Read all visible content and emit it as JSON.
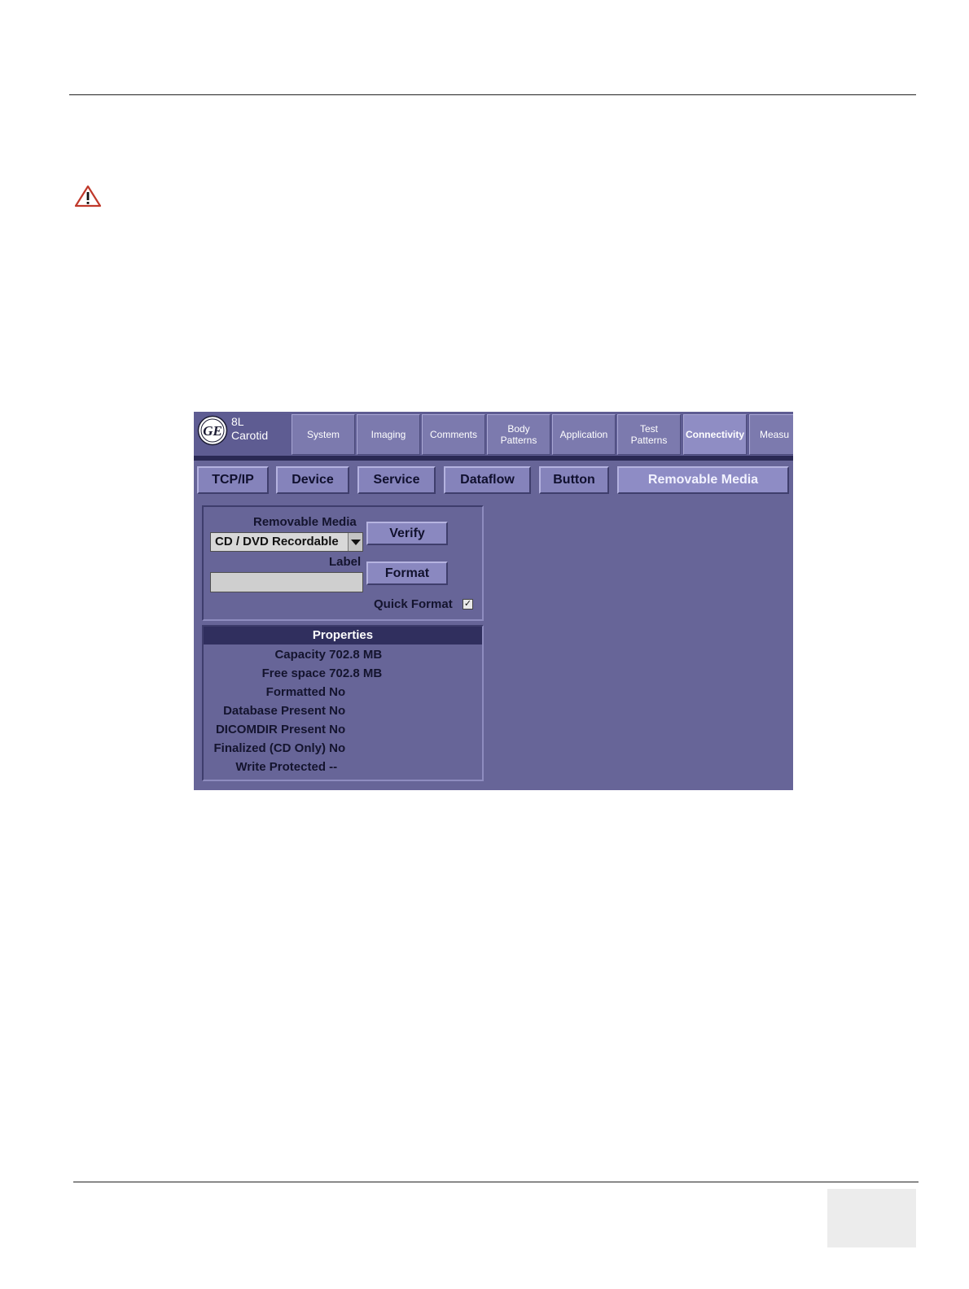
{
  "warning_icon": "warning-triangle-icon",
  "screen": {
    "logo_icon": "ge-logo-icon",
    "probe_name": "8L",
    "preset": "Carotid",
    "top_tabs": [
      {
        "label_line1": "System",
        "label_line2": ""
      },
      {
        "label_line1": "Imaging",
        "label_line2": ""
      },
      {
        "label_line1": "Comments",
        "label_line2": ""
      },
      {
        "label_line1": "Body",
        "label_line2": "Patterns"
      },
      {
        "label_line1": "Application",
        "label_line2": ""
      },
      {
        "label_line1": "Test",
        "label_line2": "Patterns"
      },
      {
        "label_line1": "Connectivity",
        "label_line2": ""
      },
      {
        "label_line1": "Measu",
        "label_line2": ""
      }
    ],
    "active_top_tab": "Connectivity",
    "sub_tabs": [
      "TCP/IP",
      "Device",
      "Service",
      "Dataflow",
      "Button",
      "Removable Media"
    ],
    "active_sub_tab": "Removable Media",
    "media": {
      "title": "Removable Media",
      "selected": "CD / DVD Recordable",
      "label_caption": "Label",
      "label_value": "",
      "verify_label": "Verify",
      "format_label": "Format",
      "quick_format_label": "Quick Format",
      "quick_format_checked": true,
      "check_mark": "✓"
    },
    "properties": {
      "title": "Properties",
      "rows": [
        {
          "key": "Capacity",
          "value": "702.8 MB"
        },
        {
          "key": "Free space",
          "value": "702.8 MB"
        },
        {
          "key": "Formatted",
          "value": "No"
        },
        {
          "key": "Database Present",
          "value": "No"
        },
        {
          "key": "DICOMDIR Present",
          "value": "No"
        },
        {
          "key": "Finalized (CD Only)",
          "value": "No"
        },
        {
          "key": "Write Protected",
          "value": "--"
        }
      ]
    },
    "colors": {
      "background": "#676598",
      "header": "#302f5e",
      "tab": "#8583bb"
    }
  }
}
